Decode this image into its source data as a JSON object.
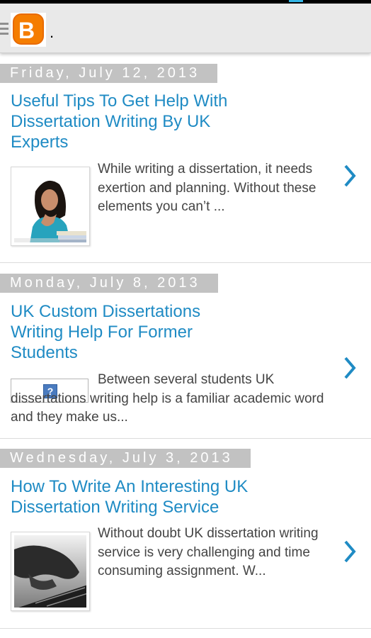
{
  "appbar": {
    "title": "."
  },
  "posts": [
    {
      "date": "Friday, July 12, 2013",
      "title": "Useful Tips To Get Help With Dissertation Writing By UK Experts",
      "snippet": "While writing a dissertation, it needs exertion and planning. Without these elements you can’t ...",
      "thumbnail": "woman-studying-photo"
    },
    {
      "date": "Monday, July 8, 2013",
      "title": "UK Custom Dissertations Writing Help For Former Students",
      "snippet": "Between several students UK dissertations writing help is a familiar academic word and they make us...",
      "thumbnail": "broken-image-icon"
    },
    {
      "date": "Wednesday, July 3, 2013",
      "title": "How To Write An Interesting UK Dissertation Writing Service",
      "snippet": "Without doubt UK dissertation writing service is very challenging and time consuming assignment. W...",
      "thumbnail": "hand-on-keyboard-photo"
    }
  ],
  "colors": {
    "link": "#1f8bc4",
    "date_bar": "#c2c2c2",
    "chevron": "#1f8bc4",
    "logo": "#f57d00"
  }
}
